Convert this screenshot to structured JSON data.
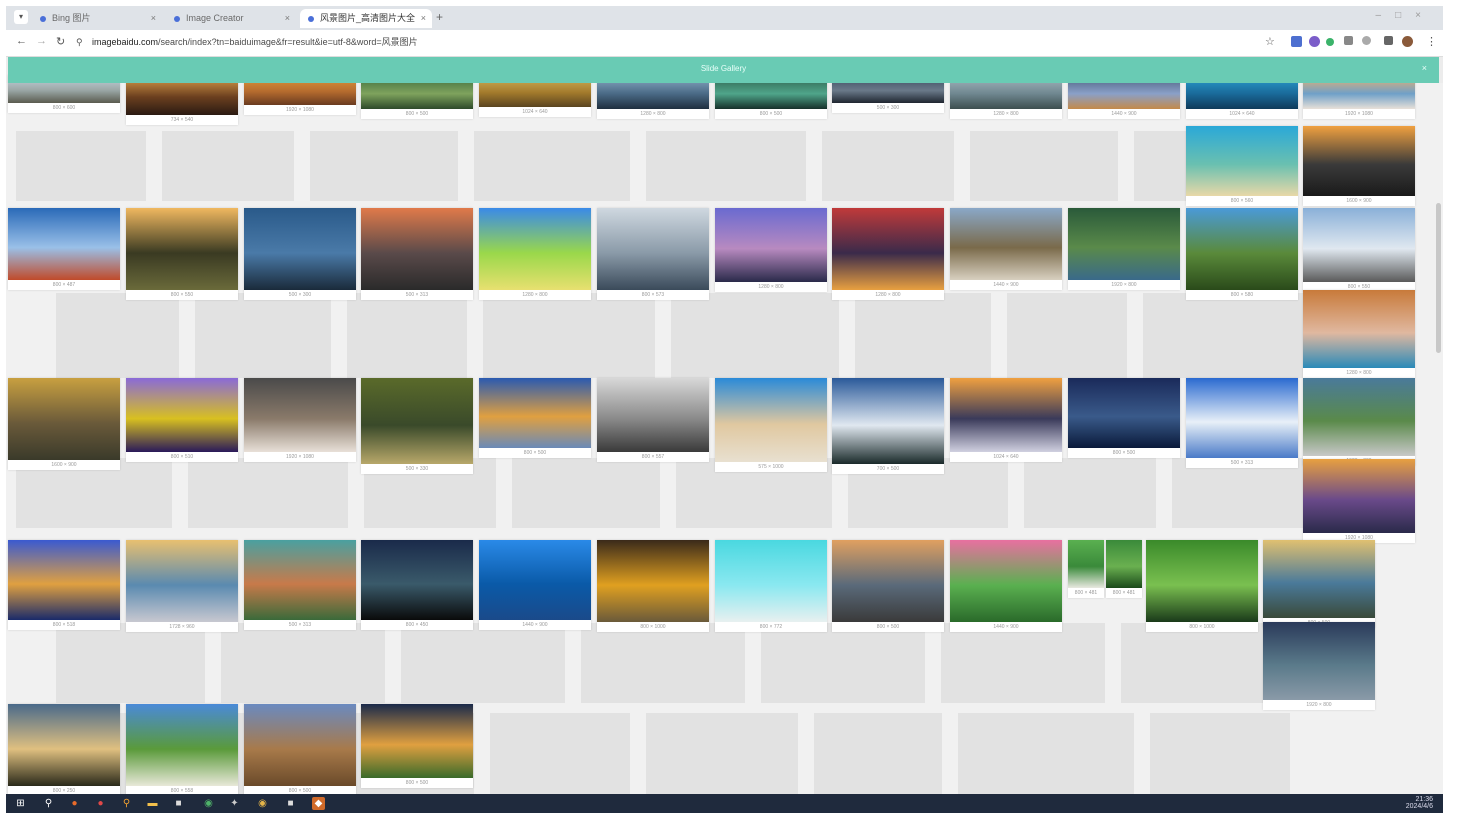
{
  "browser": {
    "tabs": [
      {
        "label": "Bing 图片",
        "active": false
      },
      {
        "label": "Image Creator",
        "active": false
      },
      {
        "label": "风景图片_高清图片大全",
        "active": true
      }
    ],
    "url_host": "imagebaidu.com",
    "url_path": "/search/index?tn=baiduimage&fr=result&ie=utf-8&word=风景图片"
  },
  "banner": {
    "text": "Slide Gallery",
    "close": "×"
  },
  "icons": {
    "back": "back-arrow-icon",
    "forward": "forward-arrow-icon",
    "reload": "reload-icon",
    "bookmark": "star-icon"
  },
  "colors": {
    "accent": "#69cbb4",
    "taskbar": "#1f2a3d"
  },
  "taskbar": {
    "time": "21:36",
    "date": "2024/4/6"
  },
  "photos": [
    {
      "dim": "800 × 600"
    },
    {
      "dim": "734 × 540"
    },
    {
      "dim": "1920 × 1080"
    },
    {
      "dim": "800 × 500"
    },
    {
      "dim": "1024 × 640"
    },
    {
      "dim": "1280 × 800"
    },
    {
      "dim": "800 × 500"
    },
    {
      "dim": "500 × 300"
    },
    {
      "dim": "1280 × 800"
    },
    {
      "dim": "1440 × 900"
    },
    {
      "dim": "1024 × 640"
    },
    {
      "dim": "1920 × 1080"
    },
    {
      "dim": "800 × 560"
    },
    {
      "dim": "1600 × 900"
    },
    {
      "dim": "800 × 487"
    },
    {
      "dim": "800 × 550"
    },
    {
      "dim": "500 × 300"
    },
    {
      "dim": "500 × 313"
    },
    {
      "dim": "1280 × 800"
    },
    {
      "dim": "800 × 573"
    },
    {
      "dim": "1280 × 800"
    },
    {
      "dim": "1280 × 800"
    },
    {
      "dim": "1440 × 900"
    },
    {
      "dim": "1920 × 800"
    },
    {
      "dim": "800 × 580"
    },
    {
      "dim": "800 × 550"
    },
    {
      "dim": "1280 × 800"
    },
    {
      "dim": "1600 × 900"
    },
    {
      "dim": "800 × 510"
    },
    {
      "dim": "1920 × 1080"
    },
    {
      "dim": "500 × 330"
    },
    {
      "dim": "800 × 500"
    },
    {
      "dim": "800 × 557"
    },
    {
      "dim": "575 × 1000"
    },
    {
      "dim": "700 × 500"
    },
    {
      "dim": "1024 × 640"
    },
    {
      "dim": "800 × 500"
    },
    {
      "dim": "500 × 313"
    },
    {
      "dim": "1920 × 800"
    },
    {
      "dim": "1920 × 1080"
    },
    {
      "dim": "800 × 518"
    },
    {
      "dim": "1728 × 960"
    },
    {
      "dim": "500 × 313"
    },
    {
      "dim": "800 × 450"
    },
    {
      "dim": "1440 × 900"
    },
    {
      "dim": "800 × 1000"
    },
    {
      "dim": "800 × 772"
    },
    {
      "dim": "800 × 500"
    },
    {
      "dim": "1440 × 900"
    },
    {
      "dim": "800 × 481"
    },
    {
      "dim": "800 × 481"
    },
    {
      "dim": "800 × 1000"
    },
    {
      "dim": "800 × 500"
    },
    {
      "dim": "1920 × 800"
    },
    {
      "dim": "800 × 250"
    },
    {
      "dim": "800 × 558"
    },
    {
      "dim": "800 × 500"
    },
    {
      "dim": "800 × 500"
    }
  ]
}
